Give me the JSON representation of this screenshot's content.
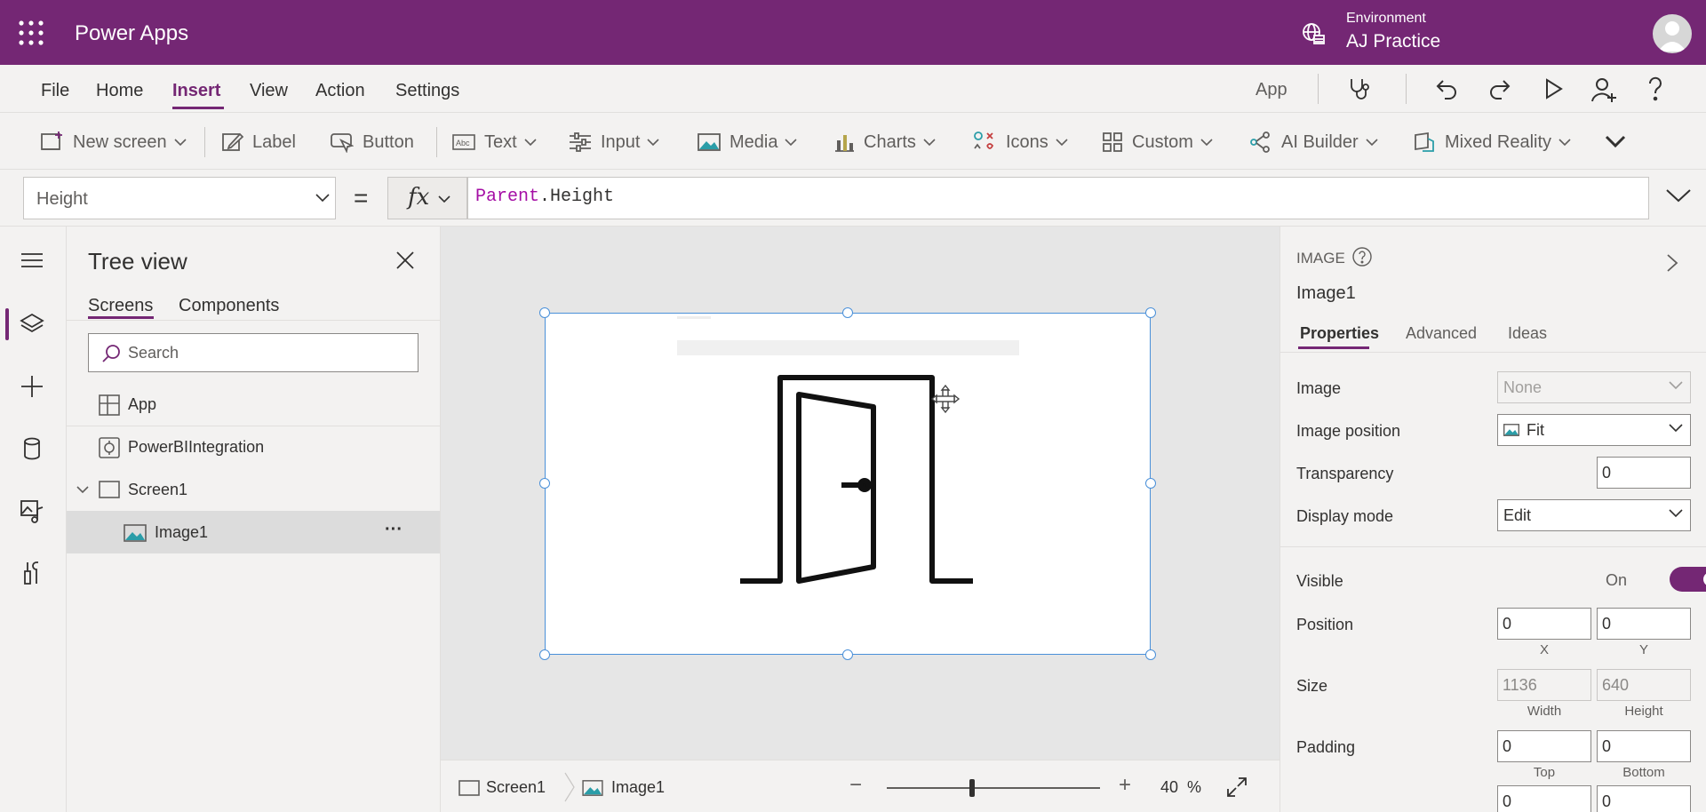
{
  "app": {
    "name": "Power Apps"
  },
  "environment": {
    "label": "Environment",
    "name": "AJ Practice"
  },
  "menu": {
    "items": [
      "File",
      "Home",
      "Insert",
      "View",
      "Action",
      "Settings"
    ],
    "active": "Insert",
    "app_link": "App"
  },
  "ribbon": {
    "new_screen": "New screen",
    "label": "Label",
    "button": "Button",
    "text": "Text",
    "input": "Input",
    "media": "Media",
    "charts": "Charts",
    "icons": "Icons",
    "custom": "Custom",
    "ai_builder": "AI Builder",
    "mixed_reality": "Mixed Reality"
  },
  "formula": {
    "property": "Height",
    "equals": "=",
    "fx": "fx",
    "keyword": "Parent",
    "rest": ".Height"
  },
  "tree": {
    "title": "Tree view",
    "tabs": [
      "Screens",
      "Components"
    ],
    "active_tab": "Screens",
    "search_placeholder": "Search",
    "items": [
      {
        "label": "App"
      },
      {
        "label": "PowerBIIntegration"
      },
      {
        "label": "Screen1"
      },
      {
        "label": "Image1",
        "selected": true,
        "more": "···"
      }
    ]
  },
  "canvas_footer": {
    "screen": "Screen1",
    "control": "Image1",
    "zoom_minus": "−",
    "zoom_plus": "+",
    "zoom_value": "40",
    "zoom_unit": "%",
    "zoom_fraction": 0.4
  },
  "properties": {
    "control_type": "IMAGE",
    "control_name": "Image1",
    "tabs": [
      "Properties",
      "Advanced",
      "Ideas"
    ],
    "active_tab": "Properties",
    "image_label": "Image",
    "image_value": "None",
    "image_position_label": "Image position",
    "image_position_value": "Fit",
    "transparency_label": "Transparency",
    "transparency_value": "0",
    "display_mode_label": "Display mode",
    "display_mode_value": "Edit",
    "visible_label": "Visible",
    "visible_value": "On",
    "position_label": "Position",
    "position_x": "0",
    "position_y": "0",
    "x_label": "X",
    "y_label": "Y",
    "size_label": "Size",
    "width_value": "1136",
    "height_value": "640",
    "width_label": "Width",
    "height_label": "Height",
    "padding_label": "Padding",
    "padding_top": "0",
    "padding_bottom": "0",
    "top_label": "Top",
    "bottom_label": "Bottom",
    "padding_left": "0",
    "padding_right": "0"
  },
  "colors": {
    "brand": "#742774",
    "selection": "#4a90d9"
  },
  "icons": [
    "waffle-icon",
    "globe-icon",
    "stethoscope-icon",
    "undo-icon",
    "redo-icon",
    "play-icon",
    "user-icon",
    "help-icon",
    "tree-layers-icon",
    "plus-icon",
    "database-icon",
    "media-icon",
    "tools-icon",
    "door-image"
  ]
}
